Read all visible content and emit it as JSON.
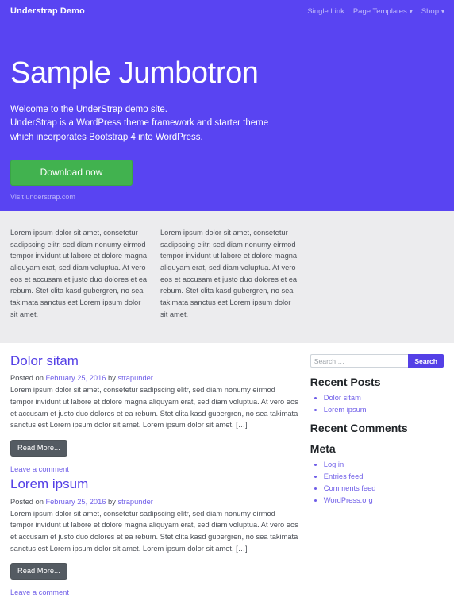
{
  "navbar": {
    "brand": "Understrap Demo",
    "links": [
      {
        "label": "Single Link",
        "caret": ""
      },
      {
        "label": "Page Templates",
        "caret": "▾"
      },
      {
        "label": "Shop",
        "caret": "▾"
      }
    ]
  },
  "jumbotron": {
    "title": "Sample Jumbotron",
    "lead_line1": "Welcome to the UnderStrap demo site.",
    "lead_line2": "UnderStrap is a WordPress theme framework and starter theme",
    "lead_line3": "which incorporates Bootstrap 4 into WordPress.",
    "button_label": "Download now",
    "visit_link": "Visit understrap.com",
    "bg_color": "#5944f2",
    "button_color": "#41b24f"
  },
  "grey_band": {
    "bg_color": "#ececee",
    "columns": [
      {
        "text": "Lorem ipsum dolor sit amet, consetetur sadipscing elitr, sed diam nonumy eirmod tempor invidunt ut labore et dolore magna aliquyam erat, sed diam voluptua. At vero eos et accusam et justo duo dolores et ea rebum. Stet clita kasd gubergren, no sea takimata sanctus est Lorem ipsum dolor sit amet."
      },
      {
        "text": "Lorem ipsum dolor sit amet, consetetur sadipscing elitr, sed diam nonumy eirmod tempor invidunt ut labore et dolore magna aliquyam erat, sed diam voluptua. At vero eos et accusam et justo duo dolores et ea rebum. Stet clita kasd gubergren, no sea takimata sanctus est Lorem ipsum dolor sit amet."
      }
    ]
  },
  "posts": [
    {
      "title": "Dolor sitam",
      "meta_prefix": "Posted on ",
      "date": "February 25, 2016",
      "meta_by": " by ",
      "author": "strapunder",
      "excerpt": "Lorem ipsum dolor sit amet, consetetur sadipscing elitr, sed diam nonumy eirmod tempor invidunt ut labore et dolore magna aliquyam erat, sed diam voluptua. At vero eos et accusam et justo duo dolores et ea rebum. Stet clita kasd gubergren, no sea takimata sanctus est Lorem ipsum dolor sit amet. Lorem ipsum dolor sit amet, […]",
      "read_more": "Read More...",
      "comment_link": "Leave a comment"
    },
    {
      "title": "Lorem ipsum",
      "meta_prefix": "Posted on ",
      "date": "February 25, 2016",
      "meta_by": " by ",
      "author": "strapunder",
      "excerpt": "Lorem ipsum dolor sit amet, consetetur sadipscing elitr, sed diam nonumy eirmod tempor invidunt ut labore et dolore magna aliquyam erat, sed diam voluptua. At vero eos et accusam et justo duo dolores et ea rebum. Stet clita kasd gubergren, no sea takimata sanctus est Lorem ipsum dolor sit amet. Lorem ipsum dolor sit amet, […]",
      "read_more": "Read More...",
      "comment_link": "Leave a comment"
    }
  ],
  "sidebar": {
    "search": {
      "placeholder": "Search …",
      "value": "",
      "button_label": "Search",
      "button_color": "#5440e6"
    },
    "widgets": [
      {
        "title": "Recent Posts",
        "items": [
          "Dolor sitam",
          "Lorem ipsum"
        ]
      },
      {
        "title": "Recent Comments",
        "items": []
      },
      {
        "title": "Meta",
        "items": [
          "Log in",
          "Entries feed",
          "Comments feed",
          "WordPress.org"
        ]
      }
    ]
  }
}
